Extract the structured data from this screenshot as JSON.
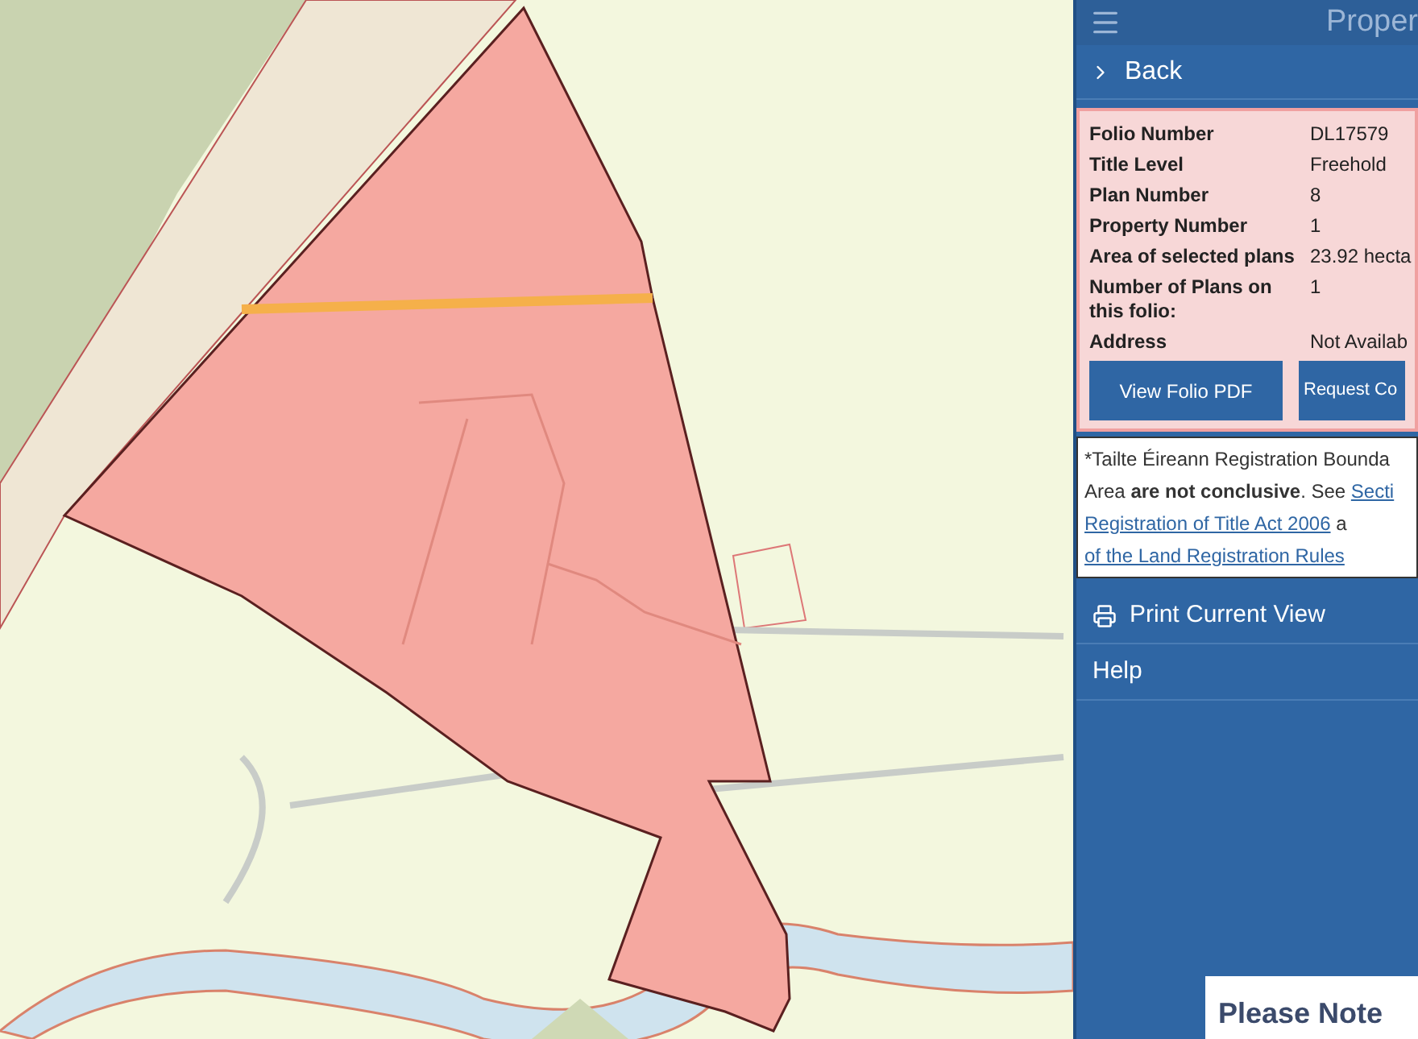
{
  "header": {
    "title": "Proper"
  },
  "back": {
    "label": "Back"
  },
  "folio": {
    "rows": [
      {
        "label": "Folio Number",
        "value": "DL17579"
      },
      {
        "label": "Title Level",
        "value": "Freehold"
      },
      {
        "label": "Plan Number",
        "value": "8"
      },
      {
        "label": "Property Number",
        "value": "1"
      },
      {
        "label": "Area of selected plans",
        "value": "23.92 hecta"
      },
      {
        "label": "Number of Plans on this folio:",
        "value": "1"
      },
      {
        "label": "Address",
        "value": "Not Availab"
      }
    ],
    "buttons": [
      "View Folio PDF",
      "Request Co"
    ]
  },
  "note": {
    "lines": [
      [
        {
          "kind": "text",
          "text": "*Tailte Éireann Registration Bounda"
        }
      ],
      [
        {
          "kind": "text",
          "text": "Area **are not conclusive**. See "
        },
        {
          "kind": "link",
          "text": "Secti"
        }
      ],
      [
        {
          "kind": "link",
          "text": "Registration of Title Act 2006"
        },
        {
          "kind": "text",
          "text": " a"
        }
      ],
      [
        {
          "kind": "link",
          "text": "of the Land Registration Rules"
        }
      ]
    ]
  },
  "menu": [
    {
      "kind": "print",
      "label": "Print Current View"
    },
    {
      "kind": "plain",
      "label": "Help"
    }
  ],
  "notice": {
    "title": "Please Note"
  }
}
